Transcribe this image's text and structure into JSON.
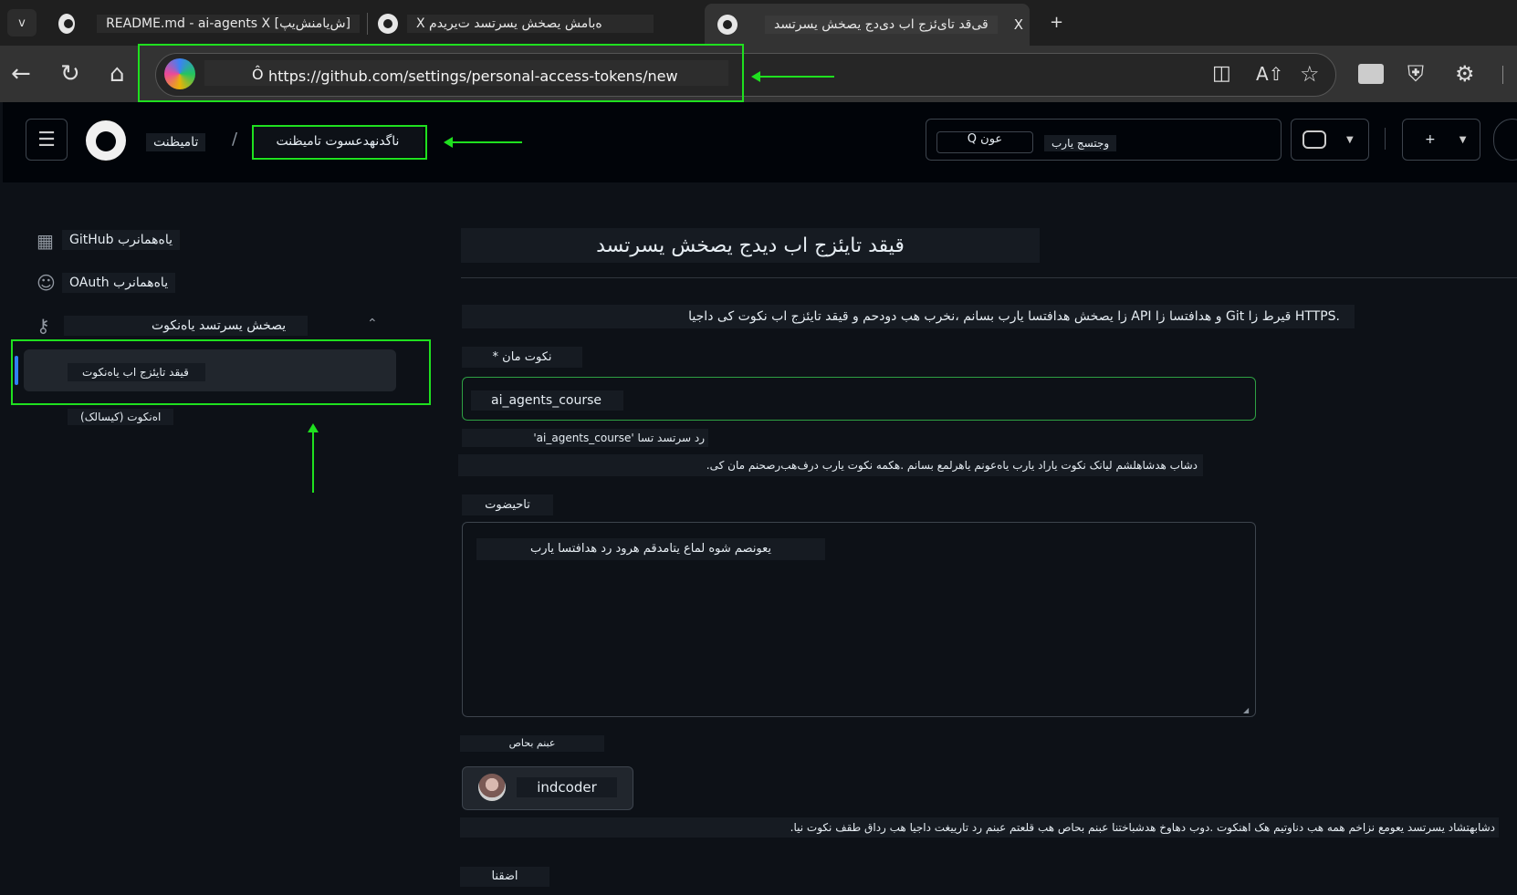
{
  "browser": {
    "tabs": [
      {
        "label": "README.md - ai-agents X [ش‌یامنش‌یپ]"
      },
      {
        "label": "X ه‌بامش یصخش یسرتسد ت‌یریدم"
      },
      {
        "label": "قی‌قد تای‌ئزج اب دی‌دج یصخش یسرتسد"
      }
    ],
    "tab_close": "X",
    "new_tab": "+",
    "tab_menu": "v",
    "url_prefix": "Ô",
    "url": "https://github.com/settings/personal-access-tokens/new"
  },
  "header": {
    "breadcrumb_parent": "تامیظنت",
    "breadcrumb_sep": "/",
    "breadcrumb_current": "ناگدنهدعسوت تامیظنت",
    "search_shortcut": "Q عون",
    "search_placeholder": "وجتسج یارب",
    "create_plus": "+"
  },
  "sidebar": {
    "items": [
      {
        "label": "GitHub یاه‌همانرب"
      },
      {
        "label": "OAuth یاه‌همانرب"
      },
      {
        "label": "یصخش یسرتسد یاه‌نکوت"
      },
      {
        "label": "قیقد تایئزج اب یاه‌نکوت"
      },
      {
        "label": "(کیسالک) اه‌نکوت"
      }
    ]
  },
  "main": {
    "title": "قیقد تایئزج اب دیدج یصخش یسرتسد",
    "intro": "زا یصخش هدافتسا یارب بسانم ،نخرب هب دودحم و قیقد تایئزج اب نکوت کی داجیا API و هدافتسا زا Git قیرط زا HTTPS.",
    "token_name_label": "* نکوت مان",
    "token_name_value": "ai_agents_course",
    "availability": "'ai_agents_course' رد سرتسد تسا",
    "unique_note": ".دشاب هدشاهلشم لیانک نکوت یاراد یارب یاه‌عونم یاهرلمع بسانم .هکمه نکوت یارب درف‌هب‌رصحنم مان کی",
    "description_label": "تاحیضوت",
    "description_placeholder": "یعونصم شوه لماع یتامدقم هرود رد هدافتسا یارب",
    "owner_label": "عبنم بحاص",
    "owner_value": "indcoder",
    "owner_note": ".دشابهتشاد یسرتسد یعومع نزاخم همه هب دناوتیم هک اهنکوت .دوب دهاوخ هدشباختنا عبنم بحاص هب قلعتم عبنم رد تاریيغت داجیا هب رداق طقف نکوت نیا",
    "expiration_label": "اضقنا"
  }
}
